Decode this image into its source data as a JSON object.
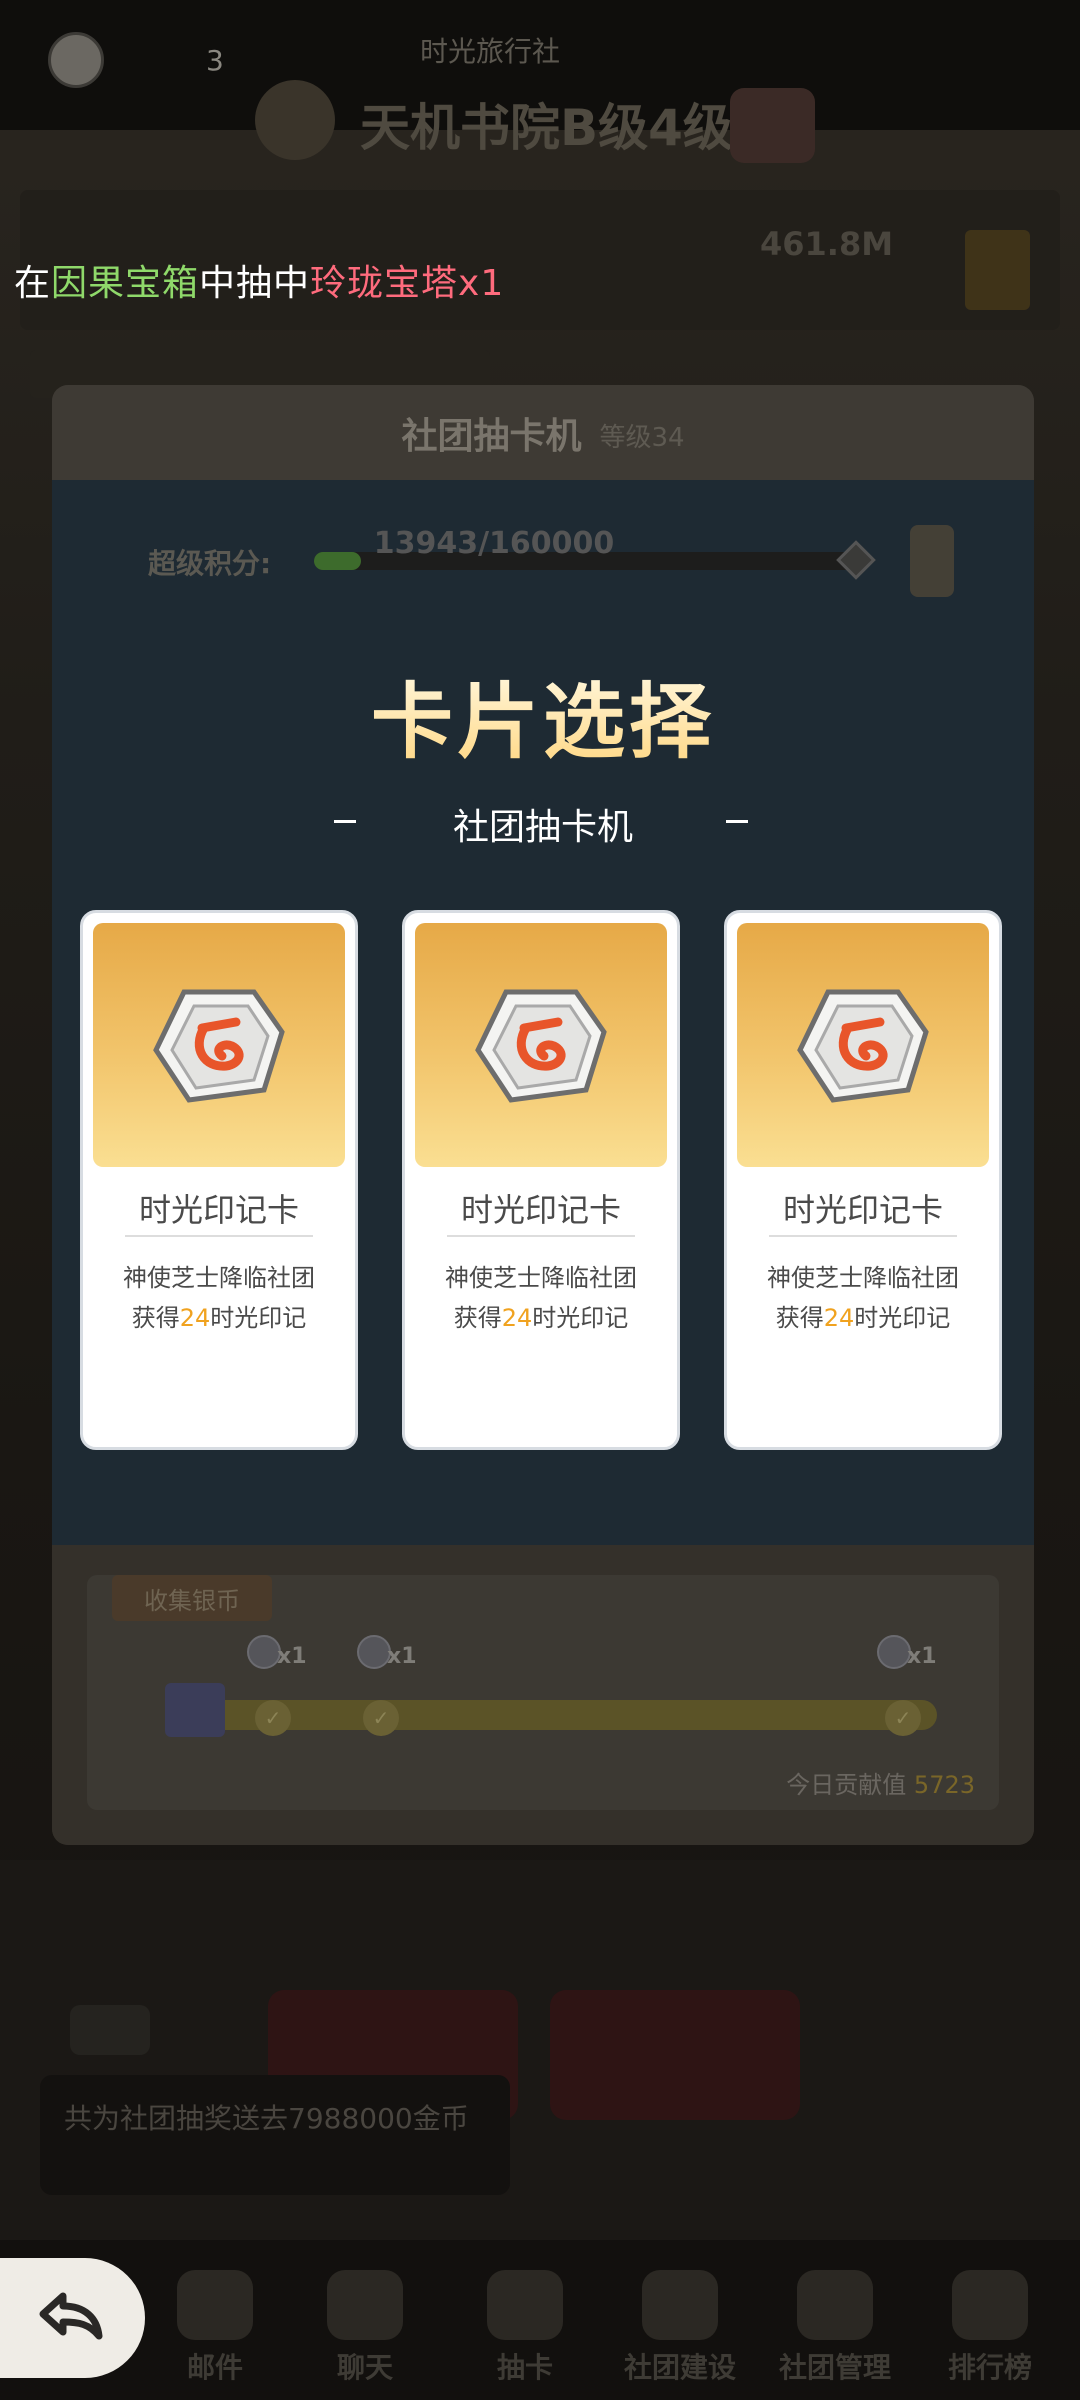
{
  "top": {
    "count": "3",
    "top_title": "时光旅行社",
    "guild_name": "天机书院B级4级",
    "amount": "461.8M"
  },
  "broadcast": {
    "part1": "在",
    "source": "因果宝箱",
    "part2": "中抽中",
    "item": "玲珑宝塔x1"
  },
  "modal": {
    "title": "社团抽卡机",
    "level": "等级34",
    "score_label": "超级积分:",
    "score_text": "13943/160000",
    "score_progress": 0.087,
    "select_title": "卡片选择",
    "select_subtitle": "社团抽卡机",
    "cards": [
      {
        "name": "时光印记卡",
        "desc_line1": "神使芝士降临社团",
        "desc_pre": "获得",
        "desc_num": "24",
        "desc_post": "时光印记"
      },
      {
        "name": "时光印记卡",
        "desc_line1": "神使芝士降临社团",
        "desc_pre": "获得",
        "desc_num": "24",
        "desc_post": "时光印记"
      },
      {
        "name": "时光印记卡",
        "desc_line1": "神使芝士降临社团",
        "desc_pre": "获得",
        "desc_num": "24",
        "desc_post": "时光印记"
      }
    ],
    "collect_tab": "收集银币",
    "coin_rewards": [
      "x1",
      "x1",
      "x1"
    ],
    "contrib_label": "今日贡献值",
    "contrib_value": "5723"
  },
  "background": {
    "message": "共为社团抽奖送去7988000金币",
    "nav": [
      "邮件",
      "聊天",
      "抽卡",
      "社团建设",
      "社团管理",
      "排行榜"
    ]
  },
  "colors": {
    "broadcast_green": "#8fd96a",
    "broadcast_pink": "#ff6b7d",
    "card_accent": "#f0a21f",
    "modal_body": "#1e2a33"
  }
}
